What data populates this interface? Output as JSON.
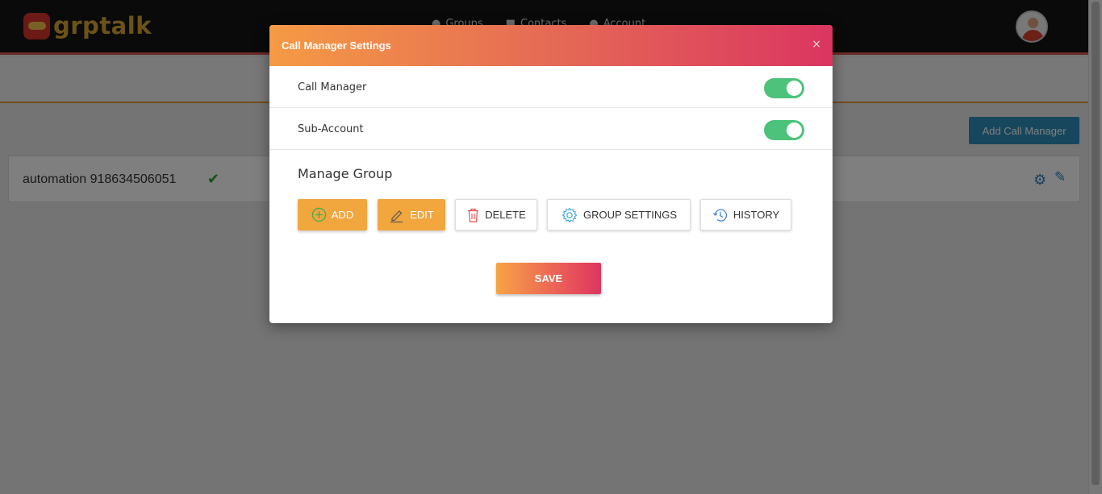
{
  "app": {
    "logo_text": "grptalk",
    "nav": [
      {
        "label": "Groups",
        "icon": "users-icon"
      },
      {
        "label": "Contacts",
        "icon": "book-icon"
      },
      {
        "label": "Account",
        "icon": "user-icon"
      }
    ],
    "avatar_icon": "avatar-icon"
  },
  "page": {
    "add_call_manager_label": "Add Call Manager",
    "row": {
      "title": "automation 918634506051",
      "check_icon": "check-icon",
      "settings_icon": "gear-icon",
      "edit_icon": "pencil-icon"
    }
  },
  "modal": {
    "title": "Call Manager Settings",
    "close_glyph": "×",
    "settings": [
      {
        "label": "Call Manager",
        "enabled": true
      },
      {
        "label": "Sub-Account",
        "enabled": true
      }
    ],
    "manage_group_title": "Manage Group",
    "buttons": {
      "add": "ADD",
      "edit": "EDIT",
      "delete": "DELETE",
      "group_settings": "GROUP SETTINGS",
      "history": "HISTORY"
    },
    "save_label": "SAVE"
  },
  "colors": {
    "header_gradient_start": "#f59a45",
    "header_gradient_end": "#db3560",
    "toggle_on": "#4cc27a",
    "orange_button": "#f2a63e",
    "primary_blue": "#2c8fb8"
  }
}
